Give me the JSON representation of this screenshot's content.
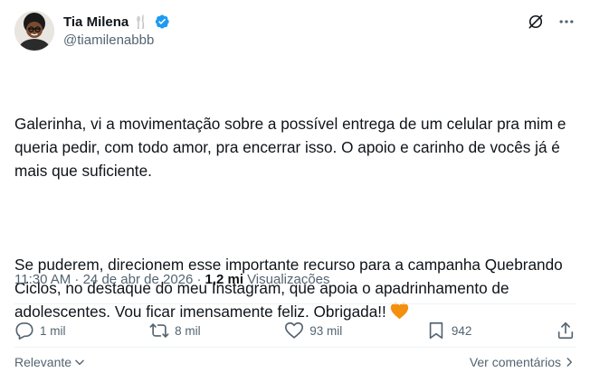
{
  "author": {
    "name": "Tia Milena",
    "name_emoji": "🍴",
    "handle": "@tiamilenabbb",
    "avatar_icon": "profile-photo",
    "verified_color": "#1d9bf0"
  },
  "header_actions": {
    "grok_icon": "grok-icon",
    "more_icon": "more-icon"
  },
  "tweet": {
    "paragraph_1": "Galerinha, vi a movimentação sobre a possível entrega de um celular pra mim e queria pedir, com todo amor, pra encerrar isso. O apoio e carinho de vocês já é mais que suficiente.",
    "paragraph_2": "Se puderem, direcionem esse importante recurso para a campanha Quebrando Ciclos, no destaque do meu Instagram, que apoia o apadrinhamento de adolescentes. Vou ficar imensamente feliz. Obrigada!!",
    "emoji": "orange-heart",
    "emoji_color": "#f4900c"
  },
  "meta": {
    "timestamp": "11:30 AM · 24 de abr de 2026 · ",
    "views_count": "1,2 mi",
    "views_label": "Visualizações"
  },
  "engagement": {
    "replies": "1 mil",
    "retweets": "8 mil",
    "likes": "93 mil",
    "bookmarks": "942"
  },
  "footer": {
    "sort_label": "Relevante",
    "see_replies_label": "Ver comentários"
  },
  "colors": {
    "text_primary": "#0f1419",
    "text_secondary": "#536471",
    "divider": "#eff3f4",
    "accent": "#1d9bf0"
  }
}
